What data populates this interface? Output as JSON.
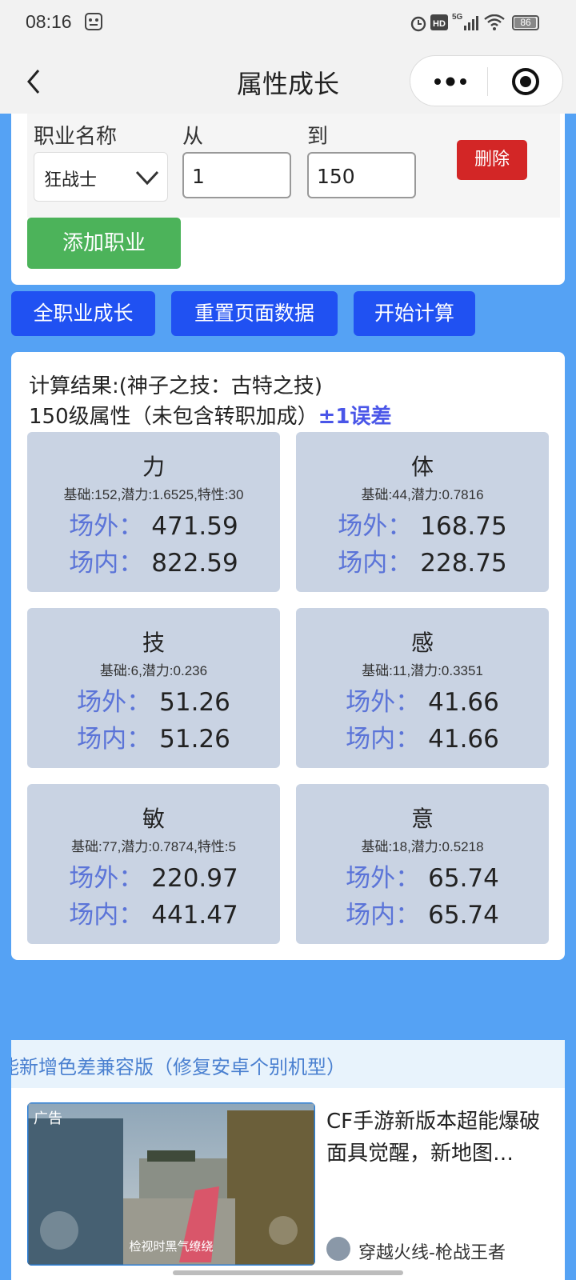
{
  "status": {
    "time": "08:16",
    "battery": "86"
  },
  "nav": {
    "title": "属性成长"
  },
  "form": {
    "job_label": "职业名称",
    "from_label": "从",
    "to_label": "到",
    "job_value": "狂战士",
    "from_value": "1",
    "to_value": "150",
    "delete_label": "删除",
    "add_label": "添加职业"
  },
  "actions": {
    "all_growth": "全职业成长",
    "reset": "重置页面数据",
    "calculate": "开始计算"
  },
  "result": {
    "title": "计算结果:(神子之技：古特之技)",
    "subtitle": "150级属性（未包含转职加成）",
    "error_note": "±1误差",
    "out_label": "场外：",
    "in_label": "场内：",
    "stats": [
      {
        "name": "力",
        "base": "基础:152,潜力:1.6525,特性:30",
        "out": "471.59",
        "in": "822.59"
      },
      {
        "name": "体",
        "base": "基础:44,潜力:0.7816",
        "out": "168.75",
        "in": "228.75"
      },
      {
        "name": "技",
        "base": "基础:6,潜力:0.236",
        "out": "51.26",
        "in": "51.26"
      },
      {
        "name": "感",
        "base": "基础:11,潜力:0.3351",
        "out": "41.66",
        "in": "41.66"
      },
      {
        "name": "敏",
        "base": "基础:77,潜力:0.7874,特性:5",
        "out": "220.97",
        "in": "441.47"
      },
      {
        "name": "意",
        "base": "基础:18,潜力:0.5218",
        "out": "65.74",
        "in": "65.74"
      }
    ]
  },
  "ad": {
    "marquee": "能新增色差兼容版（修复安卓个别机型）",
    "tag": "广告",
    "thumb_caption": "检视时黑气缭绕",
    "text": "CF手游新版本超能爆破面具觉醒，新地图…",
    "source": "穿越火线-枪战王者"
  },
  "colors": {
    "page_bg": "#55a2f4",
    "primary_blue": "#2051f2",
    "add_green": "#4cb35a",
    "delete_red": "#d32626",
    "stat_bg": "#c9d3e3",
    "stat_key": "#5b74d8"
  }
}
